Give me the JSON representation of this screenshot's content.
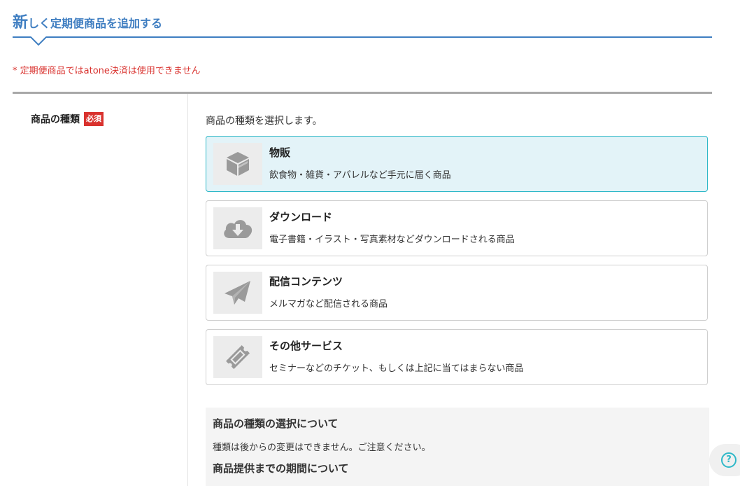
{
  "header": {
    "title_first": "新",
    "title_rest": "しく定期便商品を追加する",
    "accent_color": "#3f7ec1"
  },
  "notice": "* 定期便商品ではatone決済は使用できません",
  "field": {
    "label": "商品の種類",
    "required_badge": "必須",
    "intro": "商品の種類を選択します。"
  },
  "options": [
    {
      "icon": "box-icon",
      "title": "物販",
      "desc": "飲食物・雑貨・アパレルなど手元に届く商品",
      "selected": true
    },
    {
      "icon": "cloud-download-icon",
      "title": "ダウンロード",
      "desc": "電子書籍・イラスト・写真素材などダウンロードされる商品",
      "selected": false
    },
    {
      "icon": "paper-plane-icon",
      "title": "配信コンテンツ",
      "desc": "メルマガなど配信される商品",
      "selected": false
    },
    {
      "icon": "ticket-icon",
      "title": "その他サービス",
      "desc": "セミナーなどのチケット、もしくは上記に当てはまらない商品",
      "selected": false
    }
  ],
  "info": {
    "heading1": "商品の種類の選択について",
    "text1": "種類は後からの変更はできません。ご注意ください。",
    "heading2": "商品提供までの期間について"
  },
  "help": {
    "icon": "help-icon",
    "symbol": "?"
  }
}
